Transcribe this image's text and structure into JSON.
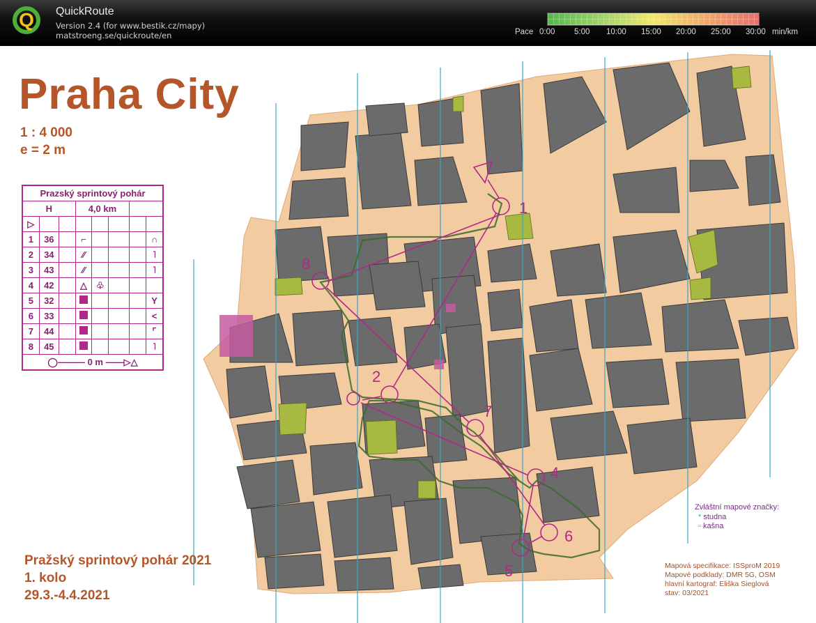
{
  "app": {
    "logo_letter": "Q",
    "title": "QuickRoute",
    "version": "Version 2.4  (for www.bestik.cz/mapy)",
    "site": "matstroeng.se/quickroute/en"
  },
  "pace": {
    "label": "Pace",
    "ticks": [
      "0:00",
      "5:00",
      "10:00",
      "15:00",
      "20:00",
      "25:00",
      "30:00"
    ],
    "unit": "min/km",
    "colors": [
      "#55b84e",
      "#9fd36a",
      "#f2e66b",
      "#f1b46a",
      "#e86f6f"
    ]
  },
  "map": {
    "title": "Praha City",
    "scale": "1 : 4 000",
    "equidistance": "e = 2 m",
    "event_lines": [
      "Pražský sprintový pohár 2021",
      "1. kolo",
      "29.3.-4.4.2021"
    ],
    "spec_lines": [
      "Mapová specifikace: ISSproM 2019",
      "Mapové podklady: DMR 5G, OSM",
      "hlavní kartograf: Eliška Sieglová",
      "stav: 03/2021"
    ],
    "legend": {
      "title": "Zvláštní mapové značky:",
      "items": [
        "studna",
        "kašna"
      ]
    },
    "control_numbers": [
      "1",
      "2",
      "4",
      "5",
      "6",
      "7",
      "8"
    ],
    "colors": {
      "building": "#6b6b6b",
      "street": "#f3cba0",
      "course": "#b0288a",
      "route": "#3a6b2a",
      "magnetic_north": "#3aa6c8",
      "text": "#b5562a"
    }
  },
  "description": {
    "header": "Prazský sprintový pohár",
    "category": "H",
    "length": "4,0 km",
    "rows": [
      {
        "n": "1",
        "code": "36",
        "feature": "stairs",
        "where": "gate"
      },
      {
        "n": "2",
        "code": "34",
        "feature": "stairs",
        "where": "corner"
      },
      {
        "n": "3",
        "code": "43",
        "feature": "stairs",
        "where": "corner"
      },
      {
        "n": "4",
        "code": "42",
        "feature": "tree",
        "where": ""
      },
      {
        "n": "5",
        "code": "32",
        "feature": "square",
        "where": "junction"
      },
      {
        "n": "6",
        "code": "33",
        "feature": "square",
        "where": "bend"
      },
      {
        "n": "7",
        "code": "44",
        "feature": "square",
        "where": "corner"
      },
      {
        "n": "8",
        "code": "45",
        "feature": "square",
        "where": "corner"
      }
    ],
    "finish": "0 m"
  }
}
